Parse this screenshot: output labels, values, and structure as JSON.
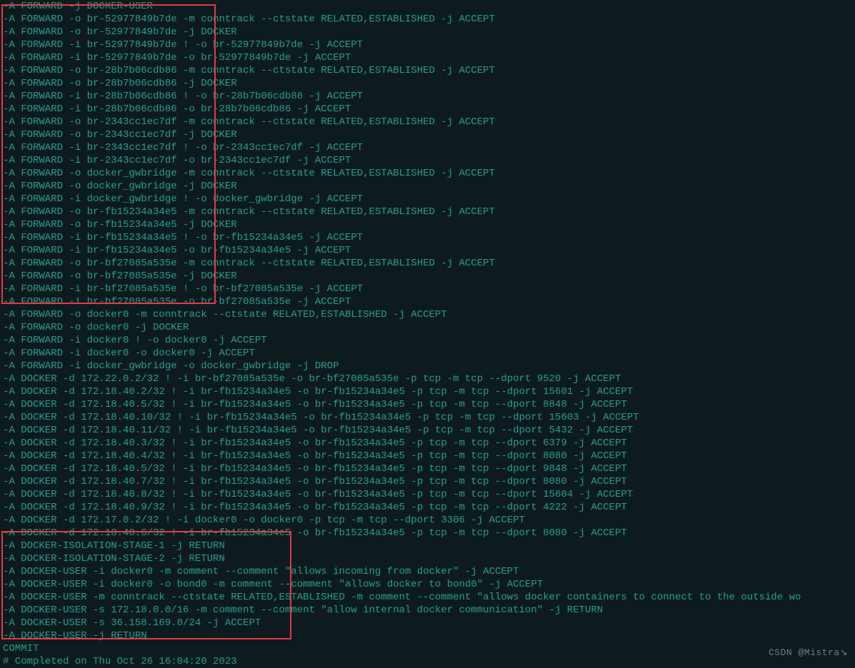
{
  "watermark": "CSDN @Mistra↘",
  "lines": [
    "-A FORWARD -j DOCKER-USER",
    "-A FORWARD -o br-52977849b7de -m conntrack --ctstate RELATED,ESTABLISHED -j ACCEPT",
    "-A FORWARD -o br-52977849b7de -j DOCKER",
    "-A FORWARD -i br-52977849b7de ! -o br-52977849b7de -j ACCEPT",
    "-A FORWARD -i br-52977849b7de -o br-52977849b7de -j ACCEPT",
    "-A FORWARD -o br-28b7b06cdb86 -m conntrack --ctstate RELATED,ESTABLISHED -j ACCEPT",
    "-A FORWARD -o br-28b7b06cdb86 -j DOCKER",
    "-A FORWARD -i br-28b7b06cdb86 ! -o br-28b7b06cdb86 -j ACCEPT",
    "-A FORWARD -i br-28b7b06cdb86 -o br-28b7b06cdb86 -j ACCEPT",
    "-A FORWARD -o br-2343cc1ec7df -m conntrack --ctstate RELATED,ESTABLISHED -j ACCEPT",
    "-A FORWARD -o br-2343cc1ec7df -j DOCKER",
    "-A FORWARD -i br-2343cc1ec7df ! -o br-2343cc1ec7df -j ACCEPT",
    "-A FORWARD -i br-2343cc1ec7df -o br-2343cc1ec7df -j ACCEPT",
    "-A FORWARD -o docker_gwbridge -m conntrack --ctstate RELATED,ESTABLISHED -j ACCEPT",
    "-A FORWARD -o docker_gwbridge -j DOCKER",
    "-A FORWARD -i docker_gwbridge ! -o docker_gwbridge -j ACCEPT",
    "-A FORWARD -o br-fb15234a34e5 -m conntrack --ctstate RELATED,ESTABLISHED -j ACCEPT",
    "-A FORWARD -o br-fb15234a34e5 -j DOCKER",
    "-A FORWARD -i br-fb15234a34e5 ! -o br-fb15234a34e5 -j ACCEPT",
    "-A FORWARD -i br-fb15234a34e5 -o br-fb15234a34e5 -j ACCEPT",
    "-A FORWARD -o br-bf27085a535e -m conntrack --ctstate RELATED,ESTABLISHED -j ACCEPT",
    "-A FORWARD -o br-bf27085a535e -j DOCKER",
    "-A FORWARD -i br-bf27085a535e ! -o br-bf27085a535e -j ACCEPT",
    "-A FORWARD -i br-bf27085a535e -o br-bf27085a535e -j ACCEPT",
    "-A FORWARD -o docker0 -m conntrack --ctstate RELATED,ESTABLISHED -j ACCEPT",
    "-A FORWARD -o docker0 -j DOCKER",
    "-A FORWARD -i docker0 ! -o docker0 -j ACCEPT",
    "-A FORWARD -i docker0 -o docker0 -j ACCEPT",
    "-A FORWARD -i docker_gwbridge -o docker_gwbridge -j DROP",
    "-A DOCKER -d 172.22.0.2/32 ! -i br-bf27085a535e -o br-bf27085a535e -p tcp -m tcp --dport 9520 -j ACCEPT",
    "-A DOCKER -d 172.18.40.2/32 ! -i br-fb15234a34e5 -o br-fb15234a34e5 -p tcp -m tcp --dport 15601 -j ACCEPT",
    "-A DOCKER -d 172.18.40.5/32 ! -i br-fb15234a34e5 -o br-fb15234a34e5 -p tcp -m tcp --dport 8848 -j ACCEPT",
    "-A DOCKER -d 172.18.40.10/32 ! -i br-fb15234a34e5 -o br-fb15234a34e5 -p tcp -m tcp --dport 15603 -j ACCEPT",
    "-A DOCKER -d 172.18.40.11/32 ! -i br-fb15234a34e5 -o br-fb15234a34e5 -p tcp -m tcp --dport 5432 -j ACCEPT",
    "-A DOCKER -d 172.18.40.3/32 ! -i br-fb15234a34e5 -o br-fb15234a34e5 -p tcp -m tcp --dport 6379 -j ACCEPT",
    "-A DOCKER -d 172.18.40.4/32 ! -i br-fb15234a34e5 -o br-fb15234a34e5 -p tcp -m tcp --dport 8080 -j ACCEPT",
    "-A DOCKER -d 172.18.40.5/32 ! -i br-fb15234a34e5 -o br-fb15234a34e5 -p tcp -m tcp --dport 9848 -j ACCEPT",
    "-A DOCKER -d 172.18.40.7/32 ! -i br-fb15234a34e5 -o br-fb15234a34e5 -p tcp -m tcp --dport 8080 -j ACCEPT",
    "-A DOCKER -d 172.18.40.8/32 ! -i br-fb15234a34e5 -o br-fb15234a34e5 -p tcp -m tcp --dport 15604 -j ACCEPT",
    "-A DOCKER -d 172.18.40.9/32 ! -i br-fb15234a34e5 -o br-fb15234a34e5 -p tcp -m tcp --dport 4222 -j ACCEPT",
    "-A DOCKER -d 172.17.0.2/32 ! -i docker0 -o docker0 -p tcp -m tcp --dport 3306 -j ACCEPT",
    "-A DOCKER -d 172.18.40.6/32 ! -i br-fb15234a34e5 -o br-fb15234a34e5 -p tcp -m tcp --dport 8080 -j ACCEPT",
    "-A DOCKER-ISOLATION-STAGE-1 -j RETURN",
    "-A DOCKER-ISOLATION-STAGE-2 -j RETURN",
    "-A DOCKER-USER -i docker0 -m comment --comment \"allows incoming from docker\" -j ACCEPT",
    "-A DOCKER-USER -i docker0 -o bond0 -m comment --comment \"allows docker to bond0\" -j ACCEPT",
    "-A DOCKER-USER -m conntrack --ctstate RELATED,ESTABLISHED -m comment --comment \"allows docker containers to connect to the outside wo",
    "-A DOCKER-USER -s 172.18.0.0/16 -m comment --comment \"allow internal docker communication\" -j RETURN",
    "-A DOCKER-USER -s 36.158.169.0/24 -j ACCEPT",
    "-A DOCKER-USER -j RETURN",
    "COMMIT",
    "# Completed on Thu Oct 26 16:04:20 2023"
  ]
}
